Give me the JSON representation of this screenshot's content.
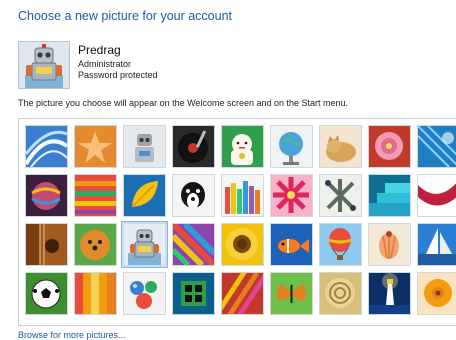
{
  "page": {
    "title": "Choose a new picture for your account",
    "note": "The picture you choose will appear on the Welcome screen and on the Start menu.",
    "browse_link": "Browse for more pictures..."
  },
  "account": {
    "name": "Predrag",
    "role": "Administrator",
    "status": "Password protected",
    "picture": "robot"
  },
  "pictures": [
    "blue-swirl",
    "starfish",
    "robot-silver",
    "record-player",
    "lucky-cat",
    "globe",
    "kitten",
    "pink-flower",
    "abstract-blue",
    "striped-ball",
    "fabric-stripes",
    "yellow-leaf",
    "black-dog",
    "crayons",
    "red-flower",
    "jacks",
    "blue-steps",
    "red-ribbon",
    "guitar",
    "pomeranian",
    "robot-selected",
    "colorful-fabric",
    "sunflower",
    "tropical-fish",
    "hot-air-balloon",
    "seashell",
    "sailboat",
    "soccer-ball",
    "orange-stripes",
    "marbles",
    "green-window",
    "rainbow-stripes",
    "butterfly",
    "cactus-spiral",
    "lighthouse",
    "orange-flower"
  ],
  "selected_index": 20
}
